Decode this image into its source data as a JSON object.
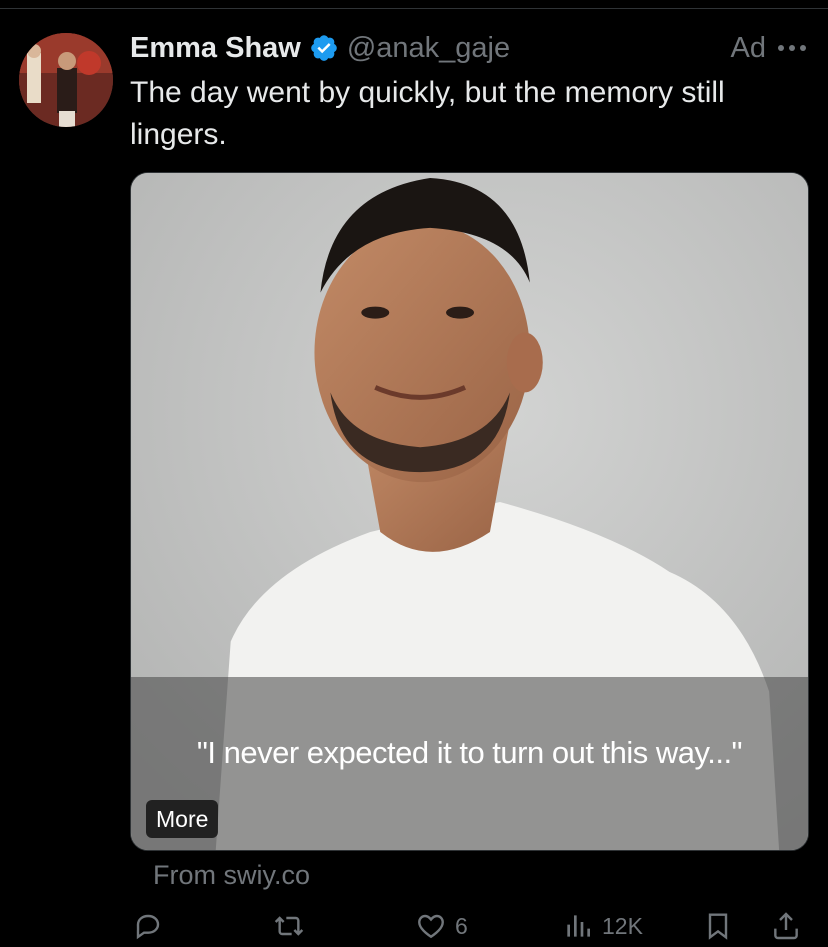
{
  "tweet": {
    "author_name": "Emma Shaw",
    "handle": "@anak_gaje",
    "ad_label": "Ad",
    "text": "The day went by quickly, but the memory still lingers.",
    "media": {
      "caption": "\"I never expected it to turn out this way...\"",
      "more_label": "More"
    },
    "source": "From swiy.co",
    "metrics": {
      "likes": "6",
      "views": "12K"
    }
  },
  "icons": {
    "verified": "verified-badge-icon",
    "more": "more-dots-icon",
    "reply": "reply-icon",
    "retweet": "retweet-icon",
    "like": "heart-icon",
    "views": "views-chart-icon",
    "bookmark": "bookmark-icon",
    "share": "share-icon"
  },
  "colors": {
    "background": "#000000",
    "text_primary": "#e7e9ea",
    "text_secondary": "#71767b",
    "verified_blue": "#1d9bf0"
  }
}
